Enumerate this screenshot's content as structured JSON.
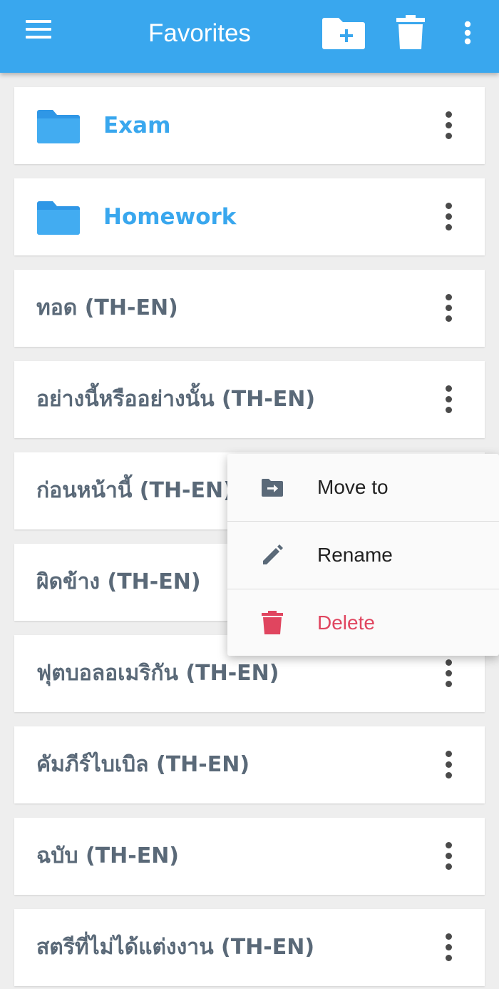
{
  "appbar": {
    "title": "Favorites",
    "icons": [
      "menu-icon",
      "new-folder-icon",
      "trash-icon",
      "more-vert-icon"
    ],
    "color": "#39a7ee"
  },
  "items": [
    {
      "label": "Exam",
      "type": "folder"
    },
    {
      "label": "Homework",
      "type": "folder"
    },
    {
      "label": "ทอด (TH-EN)",
      "type": "entry"
    },
    {
      "label": "อย่างนี้หรืออย่างนั้น (TH-EN)",
      "type": "entry"
    },
    {
      "label": "ก่อนหน้านี้ (TH-EN)",
      "type": "entry"
    },
    {
      "label": "ผิดข้าง (TH-EN)",
      "type": "entry"
    },
    {
      "label": "ฟุตบอลอเมริกัน (TH-EN)",
      "type": "entry"
    },
    {
      "label": "คัมภีร์ไบเบิล (TH-EN)",
      "type": "entry"
    },
    {
      "label": "ฉบับ (TH-EN)",
      "type": "entry"
    },
    {
      "label": "สตรีที่ไม่ได้แต่งงาน (TH-EN)",
      "type": "entry"
    }
  ],
  "context_menu": {
    "move_to": "Move to",
    "rename": "Rename",
    "delete": "Delete",
    "delete_color": "#e0455f",
    "icon_color": "#5a6978"
  }
}
